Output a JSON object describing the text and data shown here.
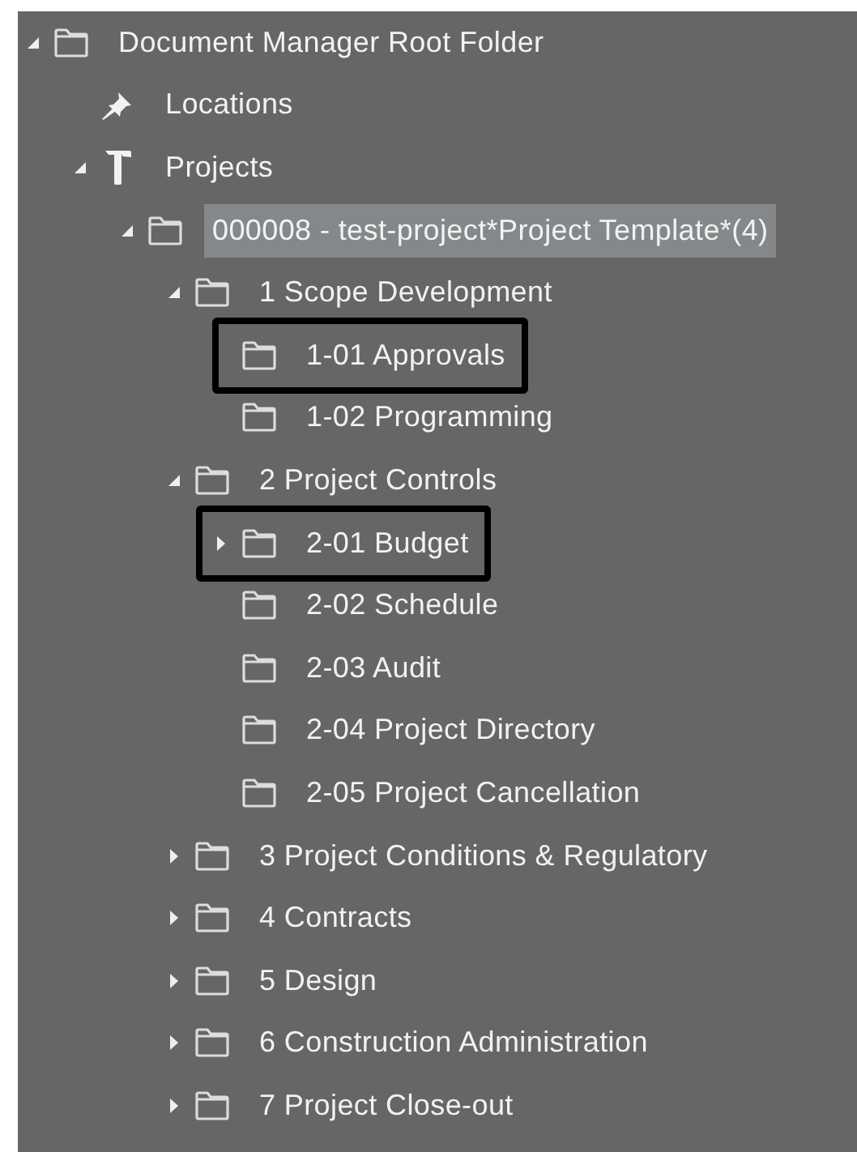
{
  "tree": [
    {
      "label": "Document Manager Root Folder",
      "kind": "folder",
      "expanded": true,
      "selected": false,
      "outlined": false,
      "children": [
        {
          "label": "Locations",
          "kind": "pin",
          "selected": false,
          "outlined": false
        },
        {
          "label": "Projects",
          "kind": "hammer",
          "expanded": true,
          "selected": false,
          "outlined": false,
          "children": [
            {
              "label": "000008 - test-project*Project Template*(4)",
              "kind": "folder",
              "expanded": true,
              "selected": true,
              "outlined": false,
              "children": [
                {
                  "label": "1 Scope Development",
                  "kind": "folder",
                  "expanded": true,
                  "selected": false,
                  "outlined": false,
                  "children": [
                    {
                      "label": "1-01 Approvals",
                      "kind": "folder",
                      "selected": false,
                      "outlined": true
                    },
                    {
                      "label": "1-02 Programming",
                      "kind": "folder",
                      "selected": false,
                      "outlined": false
                    }
                  ]
                },
                {
                  "label": "2 Project Controls",
                  "kind": "folder",
                  "expanded": true,
                  "selected": false,
                  "outlined": false,
                  "children": [
                    {
                      "label": "2-01 Budget",
                      "kind": "folder",
                      "expanded": false,
                      "selected": false,
                      "outlined": true
                    },
                    {
                      "label": "2-02 Schedule",
                      "kind": "folder",
                      "selected": false,
                      "outlined": false
                    },
                    {
                      "label": "2-03 Audit",
                      "kind": "folder",
                      "selected": false,
                      "outlined": false
                    },
                    {
                      "label": "2-04 Project Directory",
                      "kind": "folder",
                      "selected": false,
                      "outlined": false
                    },
                    {
                      "label": "2-05 Project Cancellation",
                      "kind": "folder",
                      "selected": false,
                      "outlined": false
                    }
                  ]
                },
                {
                  "label": "3 Project Conditions & Regulatory",
                  "kind": "folder",
                  "expanded": false,
                  "selected": false,
                  "outlined": false
                },
                {
                  "label": "4 Contracts",
                  "kind": "folder",
                  "expanded": false,
                  "selected": false,
                  "outlined": false
                },
                {
                  "label": "5 Design",
                  "kind": "folder",
                  "expanded": false,
                  "selected": false,
                  "outlined": false
                },
                {
                  "label": "6 Construction Administration",
                  "kind": "folder",
                  "expanded": false,
                  "selected": false,
                  "outlined": false
                },
                {
                  "label": "7 Project Close-out",
                  "kind": "folder",
                  "expanded": false,
                  "selected": false,
                  "outlined": false
                }
              ]
            }
          ]
        }
      ]
    }
  ]
}
